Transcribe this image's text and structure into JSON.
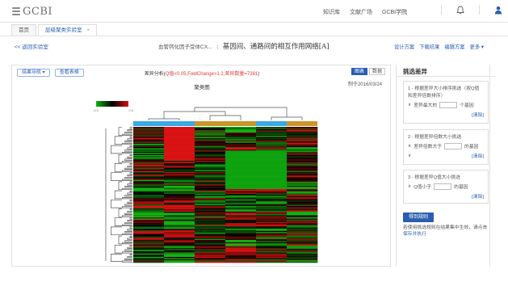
{
  "app": {
    "logo_text": "GCBI"
  },
  "nav": [
    "知识库",
    "文献广场",
    "GCBI学院"
  ],
  "tabs": [
    {
      "label": "首页",
      "active": false
    },
    {
      "label": "层级聚类实验室",
      "active": true,
      "close": "×"
    }
  ],
  "subheader": {
    "back_label": "<< 返回实验室",
    "title_prefix": "血管钙化因子受体CX...",
    "title_main": "基因间、通路间的相互作用网络[A]",
    "actions": [
      "设计方案",
      "下载结果",
      "编辑方案",
      "更多 ▾"
    ]
  },
  "panel": {
    "nav_button": "结果导航 ▾",
    "view_table_button": "查看表格",
    "analysis_prefix": "差异分析(",
    "analysis_highlight": "Q值<0.05,FoldChange>1.2,差异数量=7381",
    "analysis_suffix": ")",
    "view_toggle": [
      "图表",
      "数据"
    ],
    "chart_title": "聚类图",
    "date_label": "制于2016/03/24",
    "legend_low": "-0.5",
    "legend_high": "0.5"
  },
  "filter": {
    "title": "挑选差异",
    "box1": {
      "text": "1 - 根据差异大小排序挑选（按Q值和差异倍数排序）",
      "label": "差异最大的",
      "unit": "个基因",
      "clear": "[清除]"
    },
    "box2": {
      "text": "2 - 根据差异倍数大小挑选",
      "label": "差异倍数大于",
      "unit": "的基因",
      "clear": "[清除]"
    },
    "box3": {
      "text": "3 - 根据差异Q值大小挑选",
      "label": "Q值小于",
      "unit": "的基因",
      "clear": "[清除]"
    },
    "apply_button": "得到规则",
    "note_text": "若使用挑选规则在结果集中生效，请点击",
    "note_link": "保存并执行"
  },
  "chart_data": {
    "type": "heatmap",
    "title": "聚类图",
    "columns": 6,
    "column_groups": [
      "blue",
      "blue",
      "gold",
      "gold",
      "blue",
      "gold"
    ],
    "colormap": {
      "low": "#10b510",
      "mid": "#000000",
      "high": "#d81212"
    },
    "value_range": [
      -0.5,
      0.5
    ],
    "row_count": 120
  },
  "colors": {
    "accent": "#2a5db0",
    "highlight": "#e03a3a",
    "group_blue": "#3aa9e6",
    "group_gold": "#c9962b"
  }
}
